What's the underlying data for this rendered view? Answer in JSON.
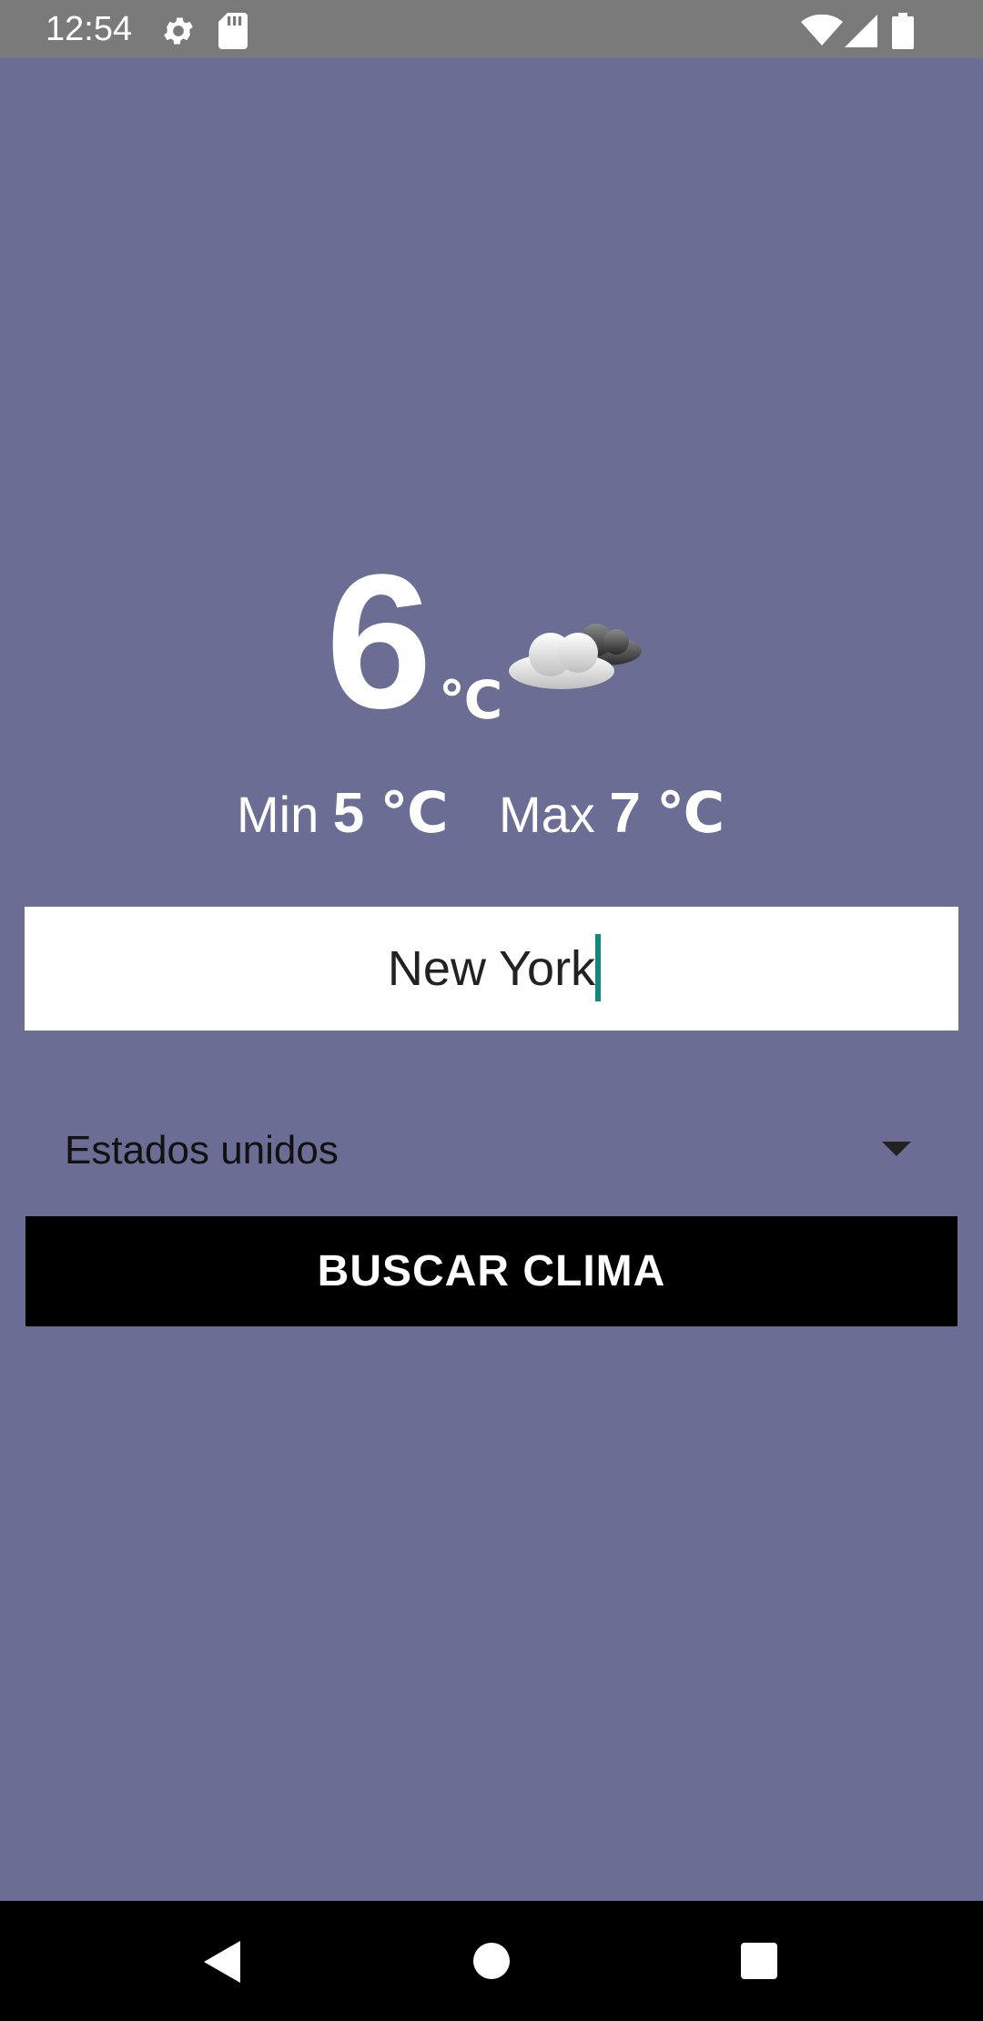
{
  "status_bar": {
    "time": "12:54",
    "icons": [
      "gear-icon",
      "sd-card-icon",
      "wifi-icon",
      "signal-icon",
      "battery-icon"
    ]
  },
  "weather": {
    "temperature": "6",
    "unit": "℃",
    "icon": "partly-cloudy-icon",
    "min_label": "Min",
    "min_value": "5 ℃",
    "max_label": "Max",
    "max_value": "7 ℃"
  },
  "search": {
    "city_value": "New York"
  },
  "country_select": {
    "selected": "Estados unidos"
  },
  "buttons": {
    "search_label": "BUSCAR CLIMA"
  },
  "nav_bar": {
    "icons": [
      "back-icon",
      "home-icon",
      "recents-icon"
    ]
  },
  "colors": {
    "background": "#6b6d94",
    "status_bar": "#7a7a7a",
    "button": "#000000",
    "cursor": "#14897b"
  }
}
